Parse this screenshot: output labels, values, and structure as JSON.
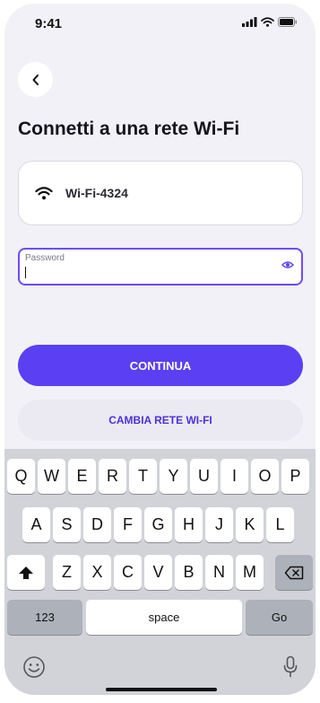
{
  "status_bar": {
    "time": "9:41"
  },
  "nav": {
    "back_icon": "chevron-left-icon"
  },
  "page": {
    "title": "Connetti a una rete Wi-Fi"
  },
  "network": {
    "icon": "wifi-icon",
    "name": "Wi-Fi-4324"
  },
  "password": {
    "label": "Password",
    "value": "",
    "icon": "eye-icon"
  },
  "buttons": {
    "continue": "CONTINUA",
    "change_network": "CAMBIA RETE WI-FI"
  },
  "keyboard": {
    "row1": [
      "Q",
      "W",
      "E",
      "R",
      "T",
      "Y",
      "U",
      "I",
      "O",
      "P"
    ],
    "row2": [
      "A",
      "S",
      "D",
      "F",
      "G",
      "H",
      "J",
      "K",
      "L"
    ],
    "row3": [
      "Z",
      "X",
      "C",
      "V",
      "B",
      "N",
      "M"
    ],
    "numbers_key": "123",
    "space_key": "space",
    "go_key": "Go",
    "shift_icon": "shift-icon",
    "backspace_icon": "backspace-icon",
    "emoji_icon": "emoji-icon",
    "mic_icon": "microphone-icon"
  },
  "colors": {
    "accent": "#5b3ff2",
    "accent_text": "#4c31d9",
    "background": "#f2f1f7"
  }
}
